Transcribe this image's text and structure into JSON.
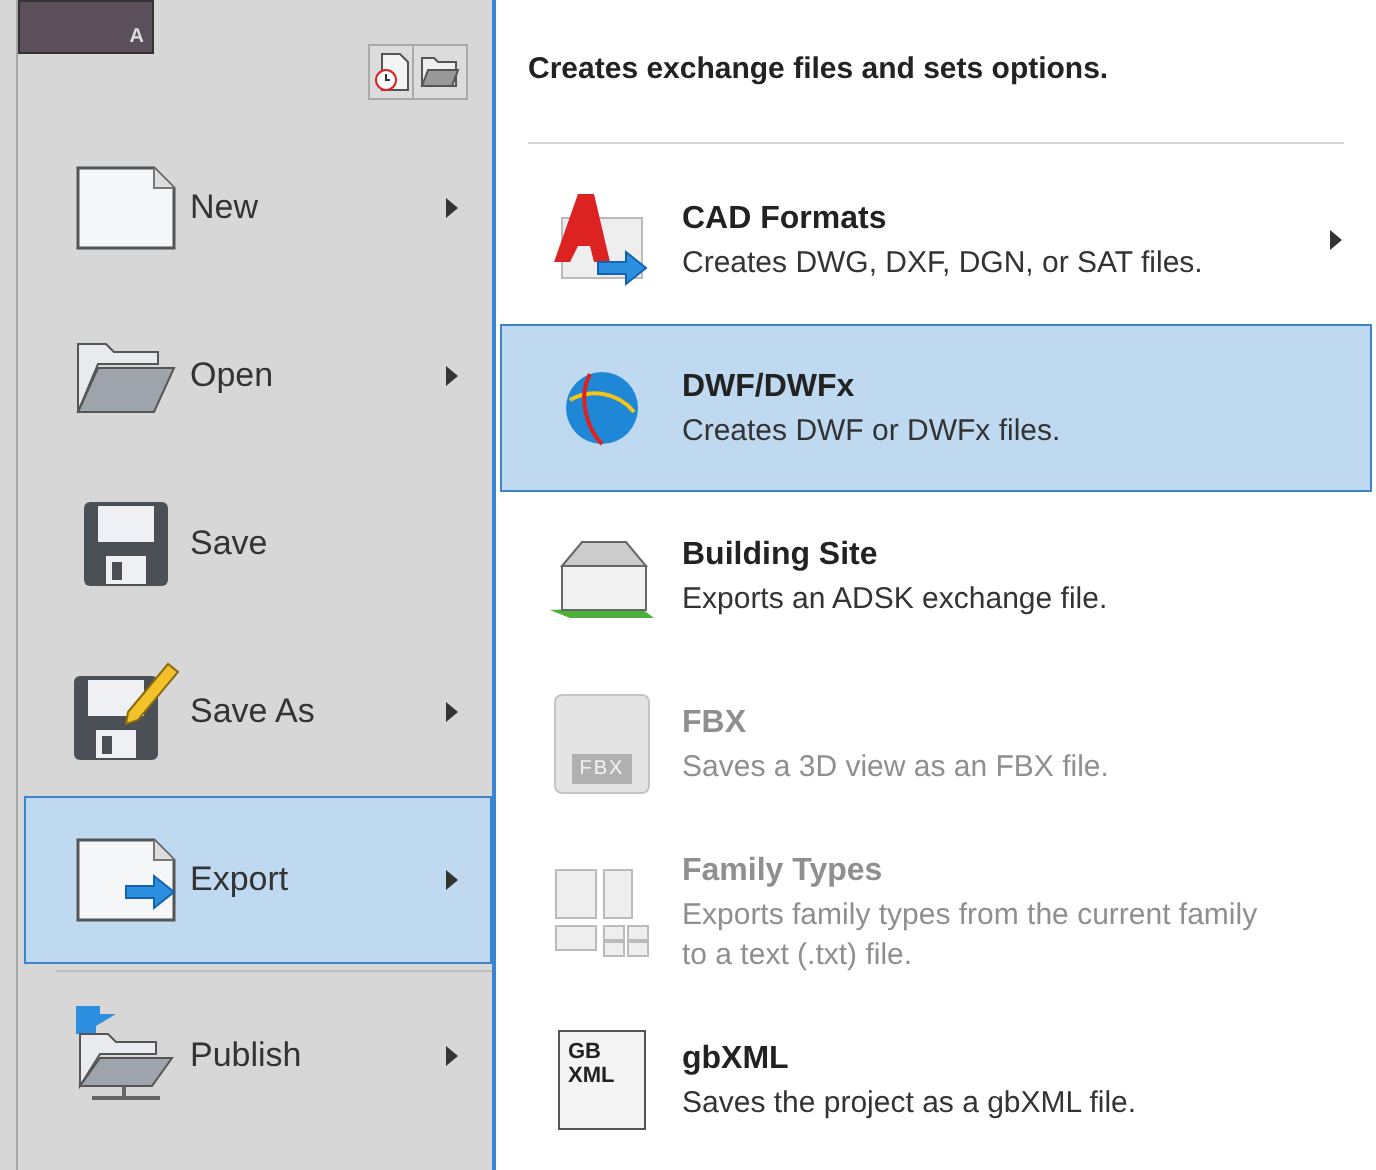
{
  "app_button": {
    "label": "A"
  },
  "left_menu": [
    {
      "label": "New",
      "selected": false,
      "has_submenu": true
    },
    {
      "label": "Open",
      "selected": false,
      "has_submenu": true
    },
    {
      "label": "Save",
      "selected": false,
      "has_submenu": false
    },
    {
      "label": "Save As",
      "selected": false,
      "has_submenu": true
    },
    {
      "label": "Export",
      "selected": true,
      "has_submenu": true
    },
    {
      "label": "Publish",
      "selected": false,
      "has_submenu": true
    }
  ],
  "submenu": {
    "header": "Creates exchange files and sets options.",
    "items": [
      {
        "title": "CAD Formats",
        "description": "Creates DWG, DXF, DGN, or SAT files.",
        "selected": false,
        "disabled": false,
        "has_submenu": true
      },
      {
        "title": "DWF/DWFx",
        "description": "Creates DWF or DWFx files.",
        "selected": true,
        "disabled": false,
        "has_submenu": false
      },
      {
        "title": "Building Site",
        "description": "Exports an ADSK exchange file.",
        "selected": false,
        "disabled": false,
        "has_submenu": false
      },
      {
        "title": "FBX",
        "description": "Saves a 3D view as an FBX file.",
        "selected": false,
        "disabled": true,
        "has_submenu": false,
        "icon_label": "FBX"
      },
      {
        "title": "Family Types",
        "description": "Exports family types from the current family to a text (.txt) file.",
        "selected": false,
        "disabled": true,
        "has_submenu": false
      },
      {
        "title": "gbXML",
        "description": "Saves the project as a gbXML file.",
        "selected": false,
        "disabled": false,
        "has_submenu": false,
        "icon_label": "GB XML"
      }
    ]
  }
}
